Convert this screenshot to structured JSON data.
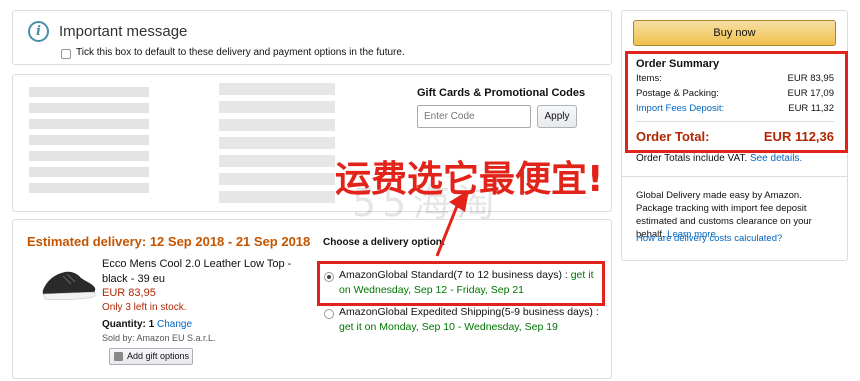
{
  "message": {
    "title": "Important message",
    "checkbox_label": "Tick this box to default to these delivery and payment options in the future."
  },
  "gift_cards": {
    "title": "Gift Cards & Promotional Codes",
    "input_placeholder": "Enter Code",
    "apply_label": "Apply"
  },
  "delivery": {
    "estimated": "Estimated delivery:  12 Sep 2018 - 21 Sep 2018",
    "choose_label": "Choose a delivery option:",
    "product": {
      "name": "Ecco Mens Cool 2.0 Leather Low Top - black - 39 eu",
      "price": "EUR 83,95",
      "stock": "Only 3 left in stock.",
      "quantity_label": "Quantity:",
      "quantity": "1",
      "change_label": "Change",
      "sold_by": "Sold by: Amazon EU S.a.r.L.",
      "gift_label": "Add gift options"
    },
    "options": [
      {
        "label": "AmazonGlobal Standard(7 to 12 business days) :",
        "date": "get it on Wednesday, Sep 12 - Friday, Sep 21",
        "selected": true
      },
      {
        "label": "AmazonGlobal Expedited Shipping(5-9 business days) :",
        "date": "get it on Monday, Sep 10 - Wednesday, Sep 19",
        "selected": false
      }
    ]
  },
  "order": {
    "buy_label": "Buy now",
    "summary_title": "Order Summary",
    "rows": [
      {
        "label": "Items:",
        "value": "EUR 83,95"
      },
      {
        "label": "Postage & Packing:",
        "value": "EUR 17,09"
      },
      {
        "label": "Import Fees Deposit:",
        "value": "EUR 11,32"
      }
    ],
    "total_label": "Order Total:",
    "total_value": "EUR 112,36",
    "vat_text": "Order Totals include VAT.",
    "vat_link": "See details.",
    "global_text": "Global Delivery made easy by Amazon. Package tracking with import fee deposit estimated and customs clearance on your behalf.",
    "global_link": "Learn more",
    "delivery_costs_link": "How are delivery costs calculated?"
  },
  "annotation": {
    "text": "运费选它最便宜!",
    "watermark": "55海淘"
  },
  "colors": {
    "accent_red": "#e2231a",
    "price_red": "#b12704",
    "green": "#007600",
    "link": "#0066c0",
    "orange": "#c45500"
  }
}
